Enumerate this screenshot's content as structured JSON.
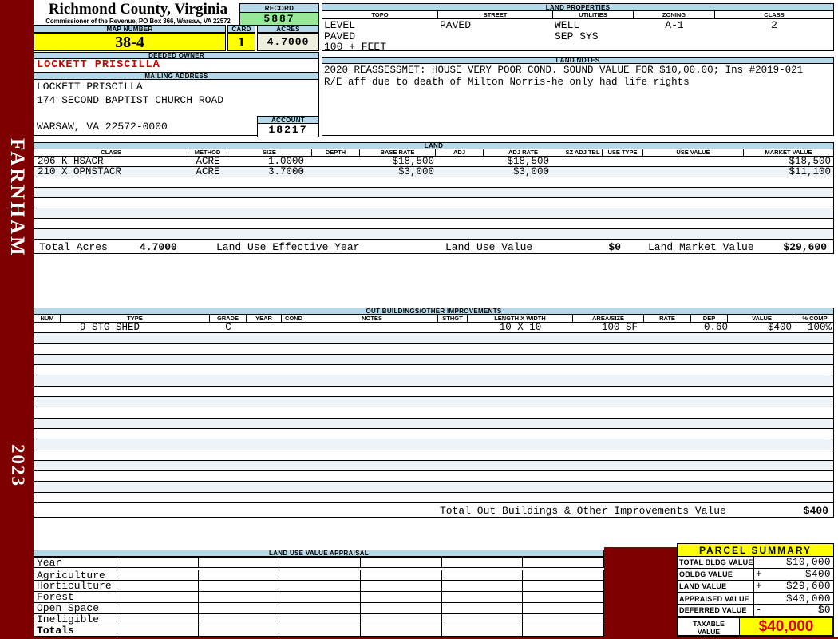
{
  "meta": {
    "county_title": "Richmond County, Virginia",
    "county_subtitle": "Commissioner of the Revenue, PO Box 366, Warsaw, VA 22572",
    "record_label": "RECORD",
    "record_value": "5887",
    "map_number_label": "MAP NUMBER",
    "map_number_value": "38-4",
    "card_label": "CARD",
    "card_value": "1",
    "acres_label": "ACRES",
    "acres_value": "4.7000",
    "district": "FARNHAM",
    "year": "2023"
  },
  "owner": {
    "deeded_owner_label": "DEEDED OWNER",
    "deeded_owner": "LOCKETT PRISCILLA",
    "mailing_address_label": "MAILING ADDRESS",
    "mailing_address": "LOCKETT PRISCILLA\n174 SECOND BAPTIST CHURCH ROAD\n\nWARSAW, VA 22572-0000",
    "account_label": "ACCOUNT",
    "account_value": "18217"
  },
  "land_properties": {
    "title": "LAND PROPERTIES",
    "columns": [
      "TOPO",
      "STREET",
      "UTILITIES",
      "ZONING",
      "CLASS"
    ],
    "topo": "LEVEL\nPAVED\n100 + FEET",
    "street": "PAVED",
    "utilities": "WELL\nSEP SYS",
    "zoning": "A-1",
    "class": "2"
  },
  "land_notes": {
    "title": "LAND NOTES",
    "line1": "2020 REASSESSMET: HOUSE VERY POOR COND. SOUND VALUE FOR $10,00.00; Ins #2019-021",
    "line2": "R/E aff due to death of Milton Norris-he only had life rights"
  },
  "land": {
    "title": "LAND",
    "columns": [
      "CLASS",
      "METHOD",
      "SIZE",
      "DEPTH",
      "BASE RATE",
      "ADJ",
      "ADJ RATE",
      "SZ ADJ TBL",
      "USE TYPE",
      "USE VALUE",
      "MARKET VALUE"
    ],
    "rows": [
      {
        "class": "206 K HSACR",
        "method": "ACRE",
        "size": "1.0000",
        "depth": "",
        "base_rate": "$18,500",
        "adj": "",
        "adj_rate": "$18,500",
        "sz_adj_tbl": "",
        "use_type": "",
        "use_value": "",
        "market_value": "$18,500"
      },
      {
        "class": "210 X OPNSTACR",
        "method": "ACRE",
        "size": "3.7000",
        "depth": "",
        "base_rate": "$3,000",
        "adj": "",
        "adj_rate": "$3,000",
        "sz_adj_tbl": "",
        "use_type": "",
        "use_value": "",
        "market_value": "$11,100"
      }
    ],
    "totals": {
      "total_acres_label": "Total Acres",
      "total_acres": "4.7000",
      "effective_year_label": "Land Use Effective Year",
      "use_value_label": "Land Use Value",
      "use_value": "$0",
      "market_value_label": "Land Market Value",
      "market_value": "$29,600"
    }
  },
  "out_buildings": {
    "title": "OUT BUILDINGS/OTHER IMPROVEMENTS",
    "columns": [
      "NUM",
      "TYPE",
      "GRADE",
      "YEAR",
      "COND",
      "NOTES",
      "STHGT",
      "LENGTH X WIDTH",
      "AREA/SIZE",
      "RATE",
      "DEP",
      "VALUE",
      "% COMP"
    ],
    "rows": [
      {
        "num": "",
        "type": "9 STG SHED",
        "grade": "C",
        "year": "",
        "cond": "",
        "notes": "",
        "sthgt": "",
        "length_width": "10 X 10",
        "area_size": "100 SF",
        "rate": "",
        "dep": "0.60",
        "value": "$400",
        "pct_comp": "100%"
      }
    ],
    "total_label": "Total Out Buildings & Other Improvements Value",
    "total_value": "$400"
  },
  "land_use_appraisal": {
    "title": "LAND USE VALUE APPRAISAL",
    "rows": [
      "Year",
      "Agriculture",
      "Horticulture",
      "Forest",
      "Open Space",
      "Ineligible",
      "Totals"
    ]
  },
  "parcel_summary": {
    "title": "PARCEL SUMMARY",
    "rows": [
      {
        "label": "TOTAL BLDG VALUE",
        "sign": "",
        "value": "$10,000"
      },
      {
        "label": "OBLDG VALUE",
        "sign": "+",
        "value": "$400"
      },
      {
        "label": "LAND VALUE",
        "sign": "+",
        "value": "$29,600"
      },
      {
        "label": "APPRAISED VALUE",
        "sign": "",
        "value": "$40,000"
      },
      {
        "label": "DEFERRED VALUE",
        "sign": "-",
        "value": "$0"
      }
    ],
    "taxable_label": "TAXABLE\nVALUE",
    "taxable_value": "$40,000"
  },
  "colors": {
    "maroon": "#7E0000",
    "header_blue": "#B5D9E8",
    "record_green": "#97E897",
    "highlight_yellow": "#FFFF00",
    "acres_beige": "#F0EEDF",
    "owner_red": "#CC0000",
    "taxable_red": "#DD0000"
  }
}
